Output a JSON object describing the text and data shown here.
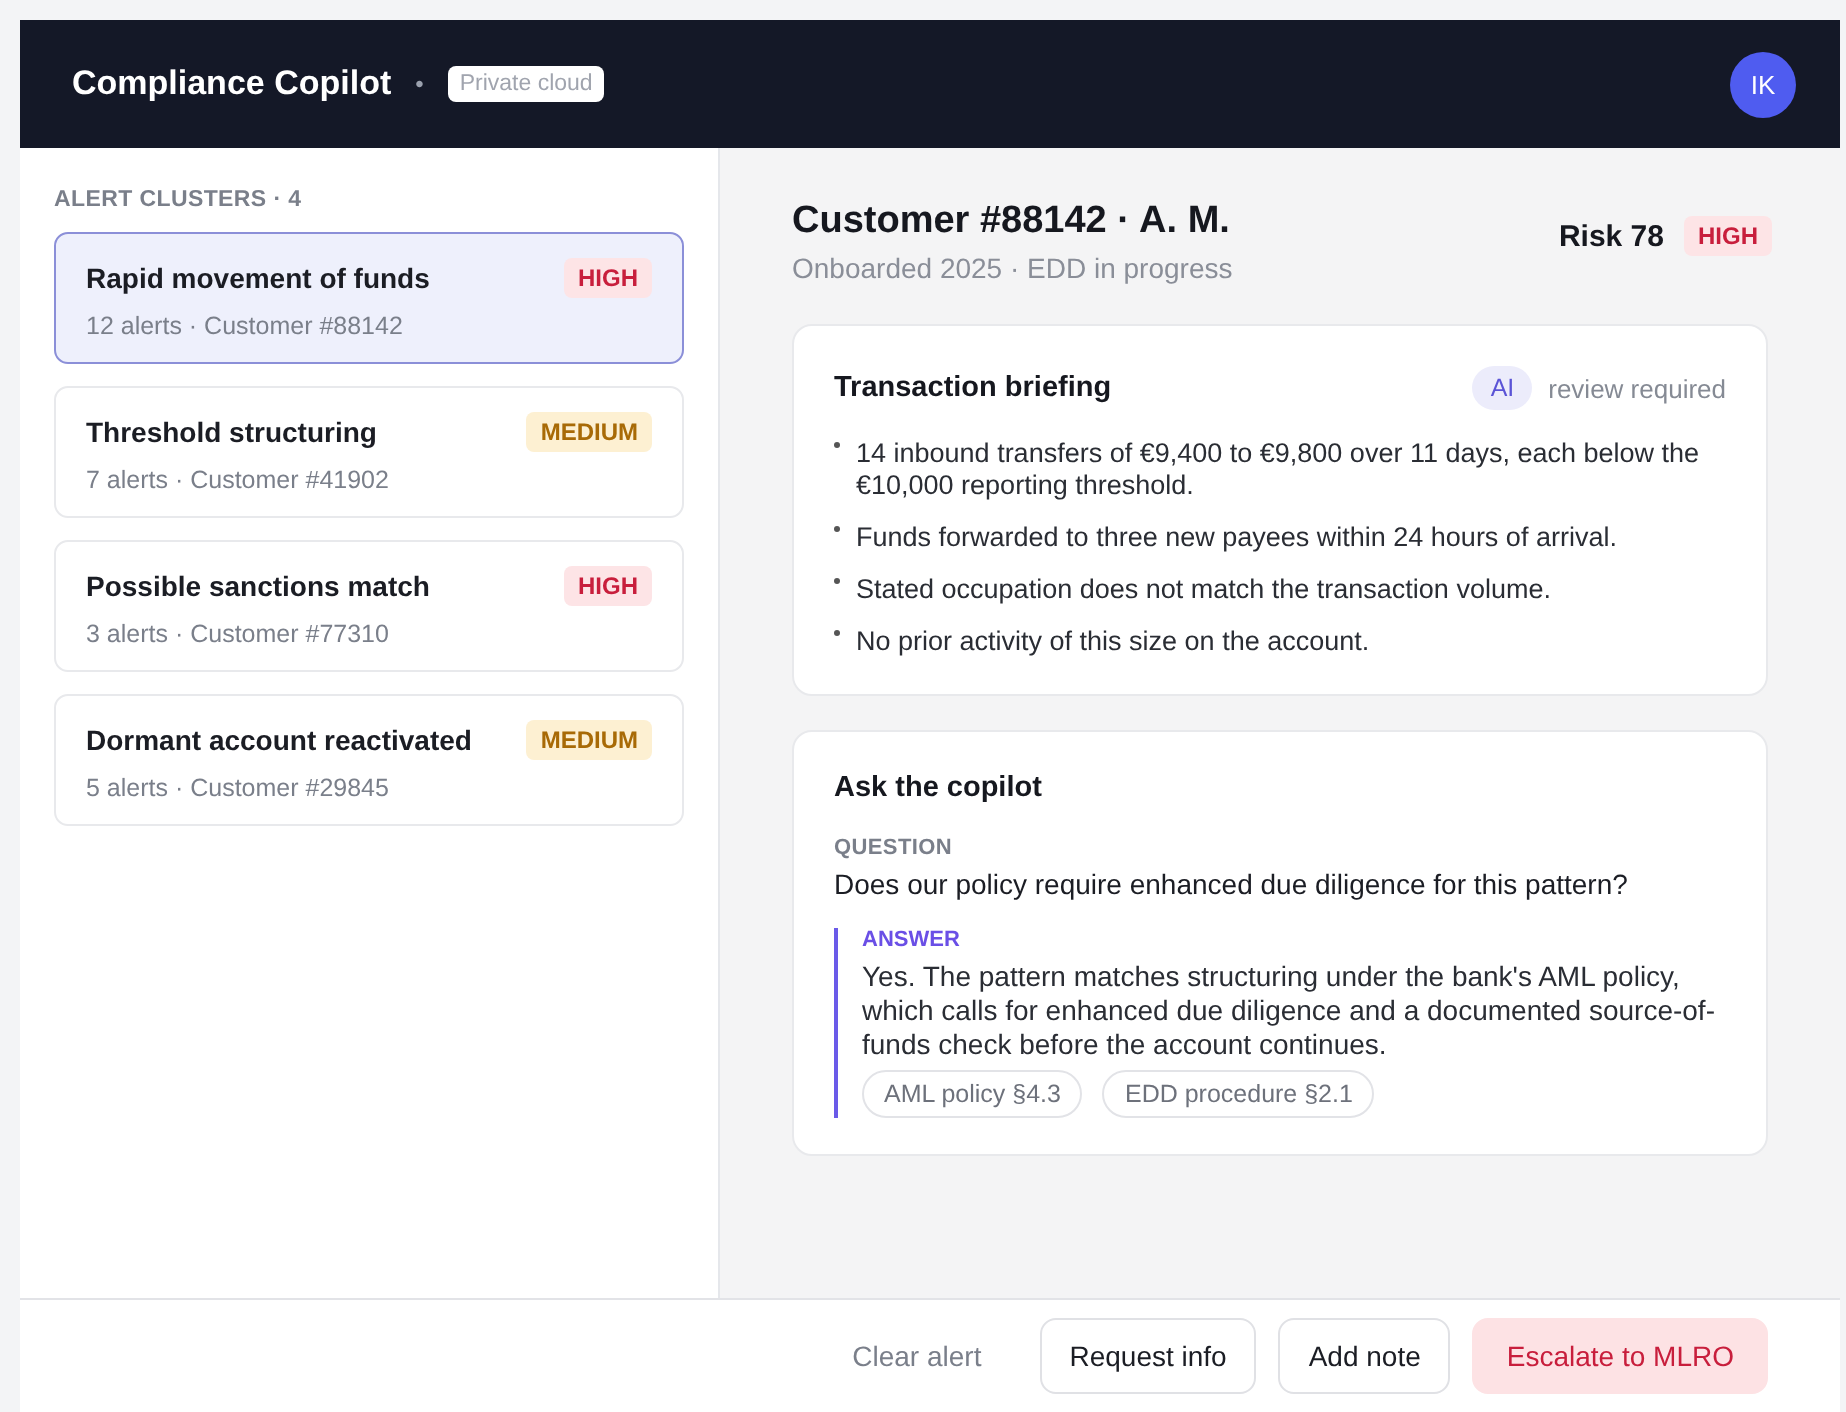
{
  "header": {
    "title": "Compliance Copilot",
    "separator": "•",
    "badge": "Private cloud",
    "avatar": "IK"
  },
  "sidebar": {
    "heading": "ALERT CLUSTERS · 4",
    "clusters": [
      {
        "title": "Rapid movement of funds",
        "meta": "12 alerts · Customer #88142",
        "severity": "HIGH",
        "kind": "high",
        "selected": true
      },
      {
        "title": "Threshold structuring",
        "meta": "7 alerts · Customer #41902",
        "severity": "MEDIUM",
        "kind": "medium",
        "selected": false
      },
      {
        "title": "Possible sanctions match",
        "meta": "3 alerts · Customer #77310",
        "severity": "HIGH",
        "kind": "high",
        "selected": false
      },
      {
        "title": "Dormant account reactivated",
        "meta": "5 alerts · Customer #29845",
        "severity": "MEDIUM",
        "kind": "medium",
        "selected": false
      }
    ]
  },
  "customer": {
    "title": "Customer #88142 · A. M.",
    "subtitle": "Onboarded 2025 · EDD in progress",
    "risk": {
      "score": "Risk 78",
      "badge": "HIGH",
      "kind": "high"
    }
  },
  "briefing": {
    "title": "Transaction briefing",
    "ai_badge": "AI",
    "note": "review required",
    "bullets": [
      "14 inbound transfers of €9,400 to €9,800 over 11 days, each below the €10,000 reporting threshold.",
      "Funds forwarded to three new payees within 24 hours of arrival.",
      "Stated occupation does not match the transaction volume.",
      "No prior activity of this size on the account."
    ]
  },
  "copilot": {
    "title": "Ask the copilot",
    "question_label": "QUESTION",
    "question": "Does our policy require enhanced due diligence for this pattern?",
    "answer_label": "ANSWER",
    "answer": "Yes. The pattern matches structuring under the bank's AML policy, which calls for enhanced due diligence and a documented source-of-funds check before the account continues.",
    "sources": [
      "AML policy §4.3",
      "EDD procedure §2.1"
    ]
  },
  "actions": [
    {
      "label": "Clear alert",
      "kind": "link"
    },
    {
      "label": "Request info",
      "kind": "secondary"
    },
    {
      "label": "Add note",
      "kind": "secondary"
    },
    {
      "label": "Escalate to MLRO",
      "kind": "danger"
    }
  ]
}
